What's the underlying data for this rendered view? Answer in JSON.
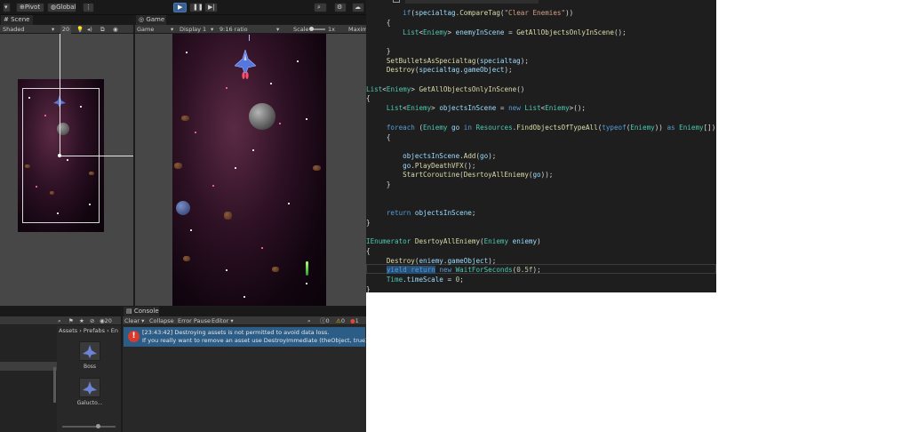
{
  "toolbar": {
    "pivot": "Pivot",
    "global": "Global"
  },
  "scene": {
    "tab": "Scene",
    "shading": "Shaded",
    "zoom": "20"
  },
  "game": {
    "tab": "Game",
    "display_mode": "Game",
    "display": "Display 1",
    "ratio": "9:16 ratio",
    "scale_label": "Scale",
    "scale_value": "1x",
    "maximize": "Maxim"
  },
  "project": {
    "count": "20",
    "breadcrumb": [
      "Assets",
      "Prefabs",
      "En"
    ],
    "assets": [
      {
        "name": "Boss"
      },
      {
        "name": "Galucto..."
      }
    ]
  },
  "console": {
    "tab": "Console",
    "clear": "Clear",
    "collapse": "Collapse",
    "error_pause": "Error Pause",
    "editor": "Editor",
    "counts": {
      "info": "0",
      "warn": "0",
      "error": "1"
    },
    "messages": [
      {
        "line1": "[23:43:42] Destroying assets is not permitted to avoid data loss.",
        "line2": "If you really want to remove an asset use DestroyImmediate (theObject, true);"
      }
    ]
  },
  "code": {
    "lines": [
      {
        "indent": 1,
        "text": "if(specialtag.CompareTag(\"Clear Enemies\"))"
      },
      {
        "indent": 1,
        "text": "{"
      },
      {
        "indent": 2,
        "text": "List<Eniemy> enemyInScene = GetAllObjectsOnlyInScene();"
      },
      {
        "indent": 1,
        "text": "}"
      },
      {
        "indent": 1,
        "text": "SetBulletsAsSpecialtag(specialtag);"
      },
      {
        "indent": 1,
        "text": "Destroy(specialtag.gameObject);"
      },
      {
        "indent": 0,
        "text": "List<Eniemy> GetAllObjectsOnlyInScene()"
      },
      {
        "indent": 0,
        "text": "{"
      },
      {
        "indent": 1,
        "text": "List<Eniemy> objectsInScene = new List<Eniemy>();"
      },
      {
        "indent": 1,
        "text": "foreach (Eniemy go in Resources.FindObjectsOfTypeAll(typeof(Eniemy)) as Eniemy[])"
      },
      {
        "indent": 1,
        "text": "{"
      },
      {
        "indent": 2,
        "text": "objectsInScene.Add(go);"
      },
      {
        "indent": 2,
        "text": "go.PlayDeathVFX();"
      },
      {
        "indent": 2,
        "text": "StartCoroutine(DesrtoyAllEniemy(go));"
      },
      {
        "indent": 1,
        "text": "}"
      },
      {
        "indent": 1,
        "text": "return objectsInScene;"
      },
      {
        "indent": 0,
        "text": "}"
      },
      {
        "indent": 0,
        "text": "IEnumerator DesrtoyAllEniemy(Eniemy eniemy)"
      },
      {
        "indent": 0,
        "text": "{"
      },
      {
        "indent": 1,
        "text": "Destroy(eniemy.gameObject);"
      },
      {
        "indent": 1,
        "text": "yield return new WaitForSeconds(0.5f);"
      },
      {
        "indent": 1,
        "text": "Time.timeScale = 0;"
      },
      {
        "indent": 0,
        "text": "}"
      }
    ]
  }
}
